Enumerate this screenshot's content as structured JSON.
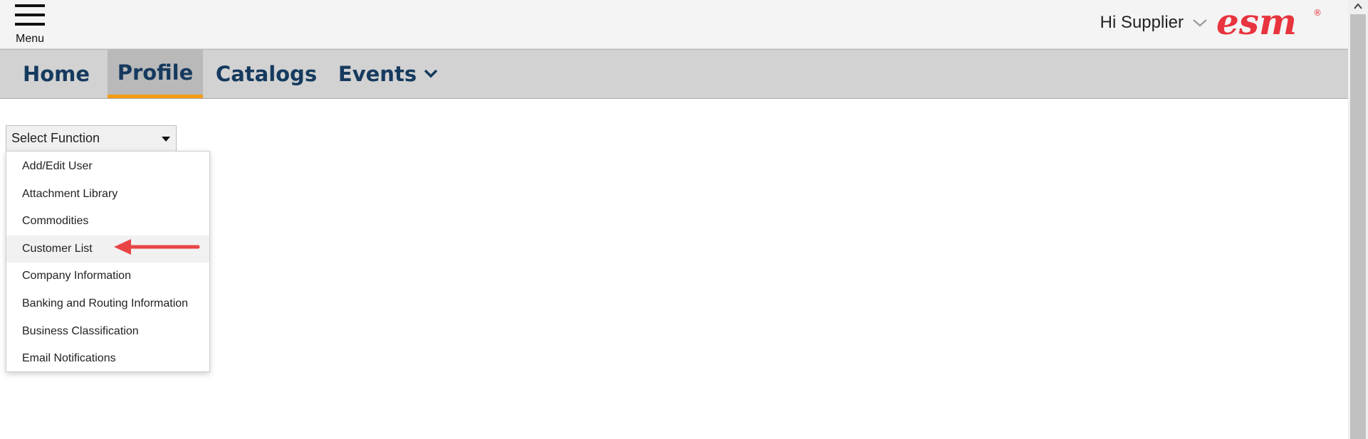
{
  "header": {
    "menu_label": "Menu",
    "greeting": "Hi Supplier",
    "logo_text": "esm",
    "logo_mark": "®"
  },
  "nav": {
    "items": [
      {
        "label": "Home",
        "active": false
      },
      {
        "label": "Profile",
        "active": true
      },
      {
        "label": "Catalogs",
        "active": false
      },
      {
        "label": "Events",
        "active": false,
        "has_dropdown": true
      }
    ]
  },
  "function_select": {
    "value": "Select Function",
    "options": [
      "Add/Edit User",
      "Attachment Library",
      "Commodities",
      "Customer List",
      "Company Information",
      "Banking and Routing Information",
      "Business Classification",
      "Email Notifications"
    ],
    "highlighted": "Customer List"
  },
  "colors": {
    "nav_text": "#163a5f",
    "active_underline": "#f39c12",
    "logo_red": "#e8343e",
    "annotation_arrow": "#e84444"
  },
  "icons": {
    "menu": "hamburger-icon",
    "greeting_chevron": "chevron-down-icon",
    "events_caret": "chevron-down-icon",
    "select_caret": "caret-down-icon",
    "annotation": "left-arrow-annotation"
  }
}
